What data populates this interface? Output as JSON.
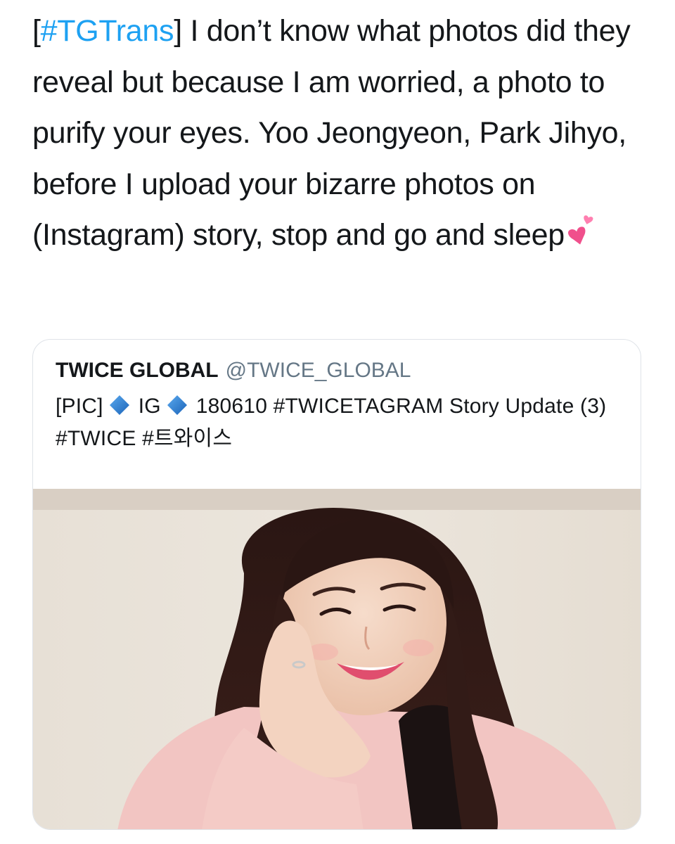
{
  "tweet": {
    "hashtag": "#TGTrans",
    "bracket_open": "[",
    "bracket_close": "]",
    "text": " I don’t know what photos did they reveal but because I am worried, a photo to purify your eyes. Yoo Jeongyeon, Park Jihyo, before I upload your bizarre photos on (Instagram) story, stop and go and sleep",
    "emoji": "two-hearts-icon"
  },
  "quoted_tweet": {
    "name": "TWICE GLOBAL",
    "handle": "@TWICE_GLOBAL",
    "text_part1": "[PIC]",
    "text_part2": "IG",
    "text_part3": "180610 #TWICETAGRAM Story Update (3) #TWICE #트와이스",
    "diamond_icon": "blue-diamond-icon",
    "diamond_color": "#2a7fd4",
    "media_icon": "photo-of-smiling-woman"
  },
  "colors": {
    "text": "#14171a",
    "link": "#1da1f2",
    "handle": "#657786",
    "border": "#dfe3e8"
  }
}
